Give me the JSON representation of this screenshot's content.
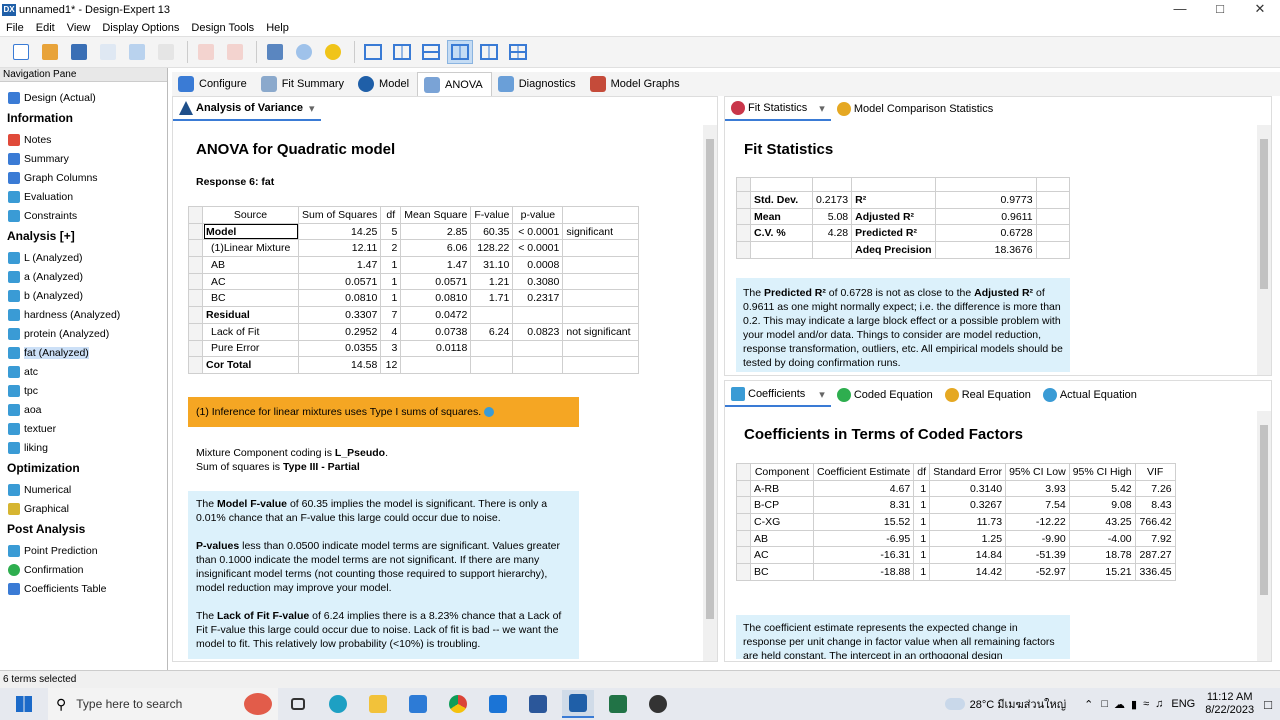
{
  "app": {
    "title": "unnamed1* - Design-Expert 13",
    "icon": "DX"
  },
  "menu": [
    "File",
    "Edit",
    "View",
    "Display Options",
    "Design Tools",
    "Help"
  ],
  "nav": {
    "header": "Navigation Pane",
    "design": "Design (Actual)",
    "information_title": "Information",
    "information": [
      "Notes",
      "Summary",
      "Graph Columns",
      "Evaluation",
      "Constraints"
    ],
    "analysis_title": "Analysis [+]",
    "analysis": [
      "L (Analyzed)",
      "a (Analyzed)",
      "b (Analyzed)",
      "hardness (Analyzed)",
      "protein (Analyzed)",
      "fat (Analyzed)",
      "atc",
      "tpc",
      "aoa",
      "textuer",
      "liking"
    ],
    "optimization_title": "Optimization",
    "optimization": [
      "Numerical",
      "Graphical"
    ],
    "post_title": "Post Analysis",
    "post": [
      "Point Prediction",
      "Confirmation",
      "Coefficients Table"
    ],
    "selected": "fat (Analyzed)"
  },
  "status": "6 terms selected",
  "tabs": [
    "Configure",
    "Fit Summary",
    "Model",
    "ANOVA",
    "Diagnostics",
    "Model Graphs"
  ],
  "active_tab": "ANOVA",
  "anova": {
    "subtab": "Analysis of Variance",
    "title": "ANOVA for Quadratic model",
    "response": "Response 6: fat",
    "headers": [
      "Source",
      "Sum of Squares",
      "df",
      "Mean Square",
      "F-value",
      "p-value",
      ""
    ],
    "rows": [
      [
        "Model",
        "14.25",
        "5",
        "2.85",
        "60.35",
        "< 0.0001",
        "significant"
      ],
      [
        "(1)Linear Mixture",
        "12.11",
        "2",
        "6.06",
        "128.22",
        "< 0.0001",
        ""
      ],
      [
        "AB",
        "1.47",
        "1",
        "1.47",
        "31.10",
        "0.0008",
        ""
      ],
      [
        "AC",
        "0.0571",
        "1",
        "0.0571",
        "1.21",
        "0.3080",
        ""
      ],
      [
        "BC",
        "0.0810",
        "1",
        "0.0810",
        "1.71",
        "0.2317",
        ""
      ],
      [
        "Residual",
        "0.3307",
        "7",
        "0.0472",
        "",
        "",
        ""
      ],
      [
        "Lack of Fit",
        "0.2952",
        "4",
        "0.0738",
        "6.24",
        "0.0823",
        "not significant"
      ],
      [
        "Pure Error",
        "0.0355",
        "3",
        "0.0118",
        "",
        "",
        ""
      ],
      [
        "Cor Total",
        "14.58",
        "12",
        "",
        "",
        "",
        ""
      ]
    ],
    "note": "(1) Inference for linear mixtures uses Type I sums of squares.",
    "coding_prefix": "Mixture Component coding is ",
    "coding_value": "L_Pseudo",
    "ss_prefix": "Sum of squares is ",
    "ss_value": "Type III - Partial",
    "p1a": "The ",
    "p1b": "Model F-value",
    "p1c": " of 60.35 implies the model is significant. There is only a 0.01% chance that an F-value this large could occur due to noise.",
    "p2a": "P-values",
    "p2b": " less than 0.0500 indicate model terms are significant. Values greater than 0.1000 indicate the model terms are not significant. If there are many insignificant model terms (not counting those required to support hierarchy), model reduction may improve your model.",
    "p3a": "The ",
    "p3b": "Lack of Fit F-value",
    "p3c": " of 6.24 implies there is a 8.23% chance that a Lack of Fit F-value this large could occur due to noise. Lack of fit is bad -- we want the model to fit. This relatively low probability (<10%) is troubling."
  },
  "fit": {
    "subtab1": "Fit Statistics",
    "subtab2": "Model Comparison Statistics",
    "title": "Fit Statistics",
    "rows": [
      [
        "Std. Dev.",
        "0.2173",
        "R²",
        "0.9773"
      ],
      [
        "Mean",
        "5.08",
        "Adjusted R²",
        "0.9611"
      ],
      [
        "C.V. %",
        "4.28",
        "Predicted R²",
        "0.6728"
      ],
      [
        "",
        "",
        "Adeq Precision",
        "18.3676"
      ]
    ],
    "i1": "The ",
    "i2": "Predicted R²",
    "i3": " of 0.6728 is not as close to the ",
    "i4": "Adjusted R²",
    "i5": " of 0.9611 as one might normally expect; i.e. the difference is more than 0.2. This may indicate a large block effect or a possible problem with your model and/or data. Things to consider are model reduction, response transformation, outliers, etc. All empirical models should be tested by doing confirmation runs."
  },
  "coef": {
    "subtabs": [
      "Coefficients",
      "Coded Equation",
      "Real Equation",
      "Actual Equation"
    ],
    "title": "Coefficients in Terms of Coded Factors",
    "headers": [
      "Component",
      "Coefficient Estimate",
      "df",
      "Standard Error",
      "95% CI Low",
      "95% CI High",
      "VIF"
    ],
    "rows": [
      [
        "A-RB",
        "4.67",
        "1",
        "0.3140",
        "3.93",
        "5.42",
        "7.26"
      ],
      [
        "B-CP",
        "8.31",
        "1",
        "0.3267",
        "7.54",
        "9.08",
        "8.43"
      ],
      [
        "C-XG",
        "15.52",
        "1",
        "11.73",
        "-12.22",
        "43.25",
        "766.42"
      ],
      [
        "AB",
        "-6.95",
        "1",
        "1.25",
        "-9.90",
        "-4.00",
        "7.92"
      ],
      [
        "AC",
        "-16.31",
        "1",
        "14.84",
        "-51.39",
        "18.78",
        "287.27"
      ],
      [
        "BC",
        "-18.88",
        "1",
        "14.42",
        "-52.97",
        "15.21",
        "336.45"
      ]
    ],
    "info": "The coefficient estimate represents the expected change in response per unit change in factor value when all remaining factors are held constant. The intercept in an orthogonal design"
  },
  "taskbar": {
    "search": "Type here to search",
    "weather": "28°C มีเมฆส่วนใหญ่",
    "lang": "ENG",
    "time": "11:12 AM",
    "date": "8/22/2023"
  }
}
